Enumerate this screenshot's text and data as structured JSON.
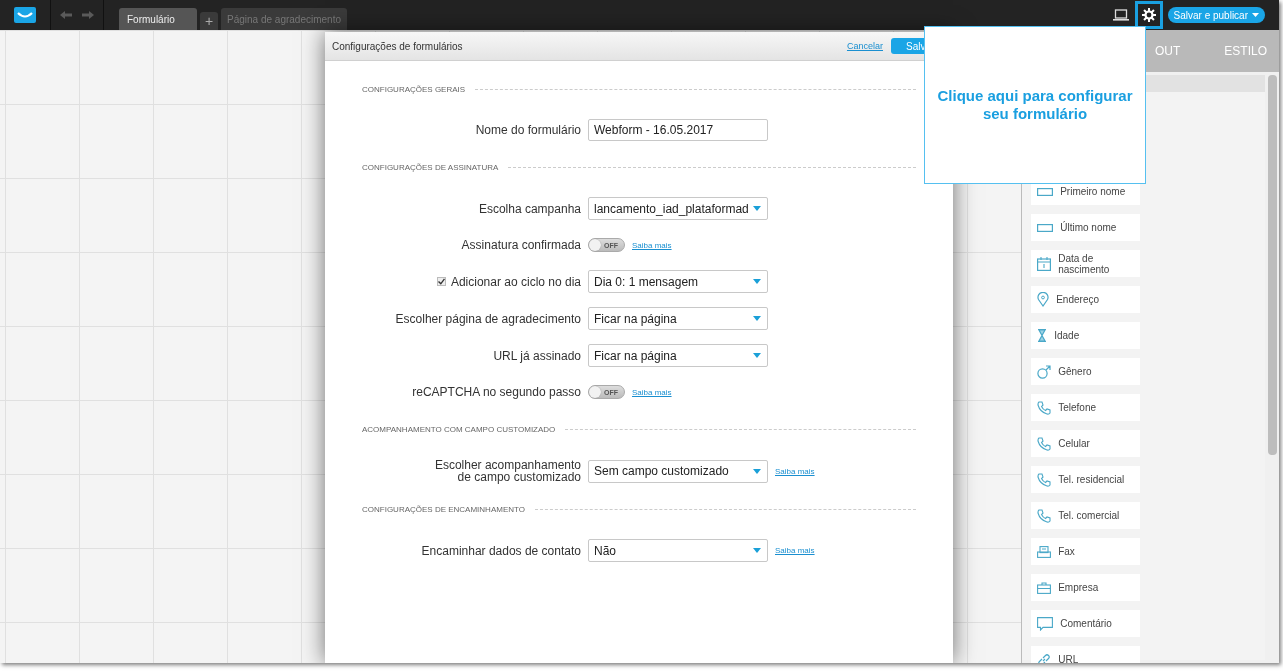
{
  "topbar": {
    "tabs": [
      {
        "label": "Formulário",
        "selected": true
      },
      {
        "label": "Página de agradecimento",
        "selected": false
      }
    ],
    "add_tab": "+",
    "publish_button": "Salvar e publicar"
  },
  "side_panel": {
    "tabs": [
      "OUT",
      "ESTILO"
    ],
    "fields": [
      {
        "label": "Primeiro nome",
        "kind": "field"
      },
      {
        "label": "Último nome",
        "kind": "field"
      },
      {
        "label": "Data de nascimento",
        "kind": "calendar"
      },
      {
        "label": "Endereço",
        "kind": "pin"
      },
      {
        "label": "Idade",
        "kind": "hourglass"
      },
      {
        "label": "Gênero",
        "kind": "gender"
      },
      {
        "label": "Telefone",
        "kind": "phone"
      },
      {
        "label": "Celular",
        "kind": "phone"
      },
      {
        "label": "Tel. residencial",
        "kind": "phone"
      },
      {
        "label": "Tel. comercial",
        "kind": "phone"
      },
      {
        "label": "Fax",
        "kind": "fax"
      },
      {
        "label": "Empresa",
        "kind": "briefcase"
      },
      {
        "label": "Comentário",
        "kind": "comment"
      },
      {
        "label": "URL",
        "kind": "link"
      }
    ]
  },
  "dialog": {
    "title": "Configurações de formulários",
    "cancel": "Cancelar",
    "save": "Salv",
    "sections": [
      {
        "heading": "CONFIGURAÇÕES GERAIS",
        "rows": [
          {
            "kind": "text",
            "label": "Nome do formulário",
            "value": "Webform - 16.05.2017"
          }
        ]
      },
      {
        "heading": "CONFIGURAÇÕES DE ASSINATURA",
        "rows": [
          {
            "kind": "select",
            "label": "Escolha campanha",
            "value": "lancamento_iad_plataformad"
          },
          {
            "kind": "toggle",
            "label": "Assinatura confirmada",
            "on": false,
            "state_text": "OFF",
            "link": "Saiba mais"
          },
          {
            "kind": "select",
            "label": "Adicionar ao ciclo no dia",
            "checked": true,
            "value": "Dia 0: 1 mensagem"
          },
          {
            "kind": "select",
            "label": "Escolher página de agradecimento",
            "value": "Ficar na página"
          },
          {
            "kind": "select",
            "label": "URL já assinado",
            "value": "Ficar na página"
          },
          {
            "kind": "toggle",
            "label": "reCAPTCHA no segundo passo",
            "on": false,
            "state_text": "OFF",
            "link": "Saiba mais"
          }
        ]
      },
      {
        "heading": "ACOMPANHAMENTO COM CAMPO CUSTOMIZADO",
        "rows": [
          {
            "kind": "select",
            "label": "Escolher acompanhamento de campo customizado",
            "value": "Sem campo customizado",
            "link": "Saiba mais"
          }
        ]
      },
      {
        "heading": "CONFIGURAÇÕES DE ENCAMINHAMENTO",
        "rows": [
          {
            "kind": "select",
            "label": "Encaminhar dados de contato",
            "value": "Não",
            "link": "Saiba mais"
          }
        ]
      }
    ]
  },
  "callout": {
    "text": "Clique aqui para configurar seu formulário"
  }
}
